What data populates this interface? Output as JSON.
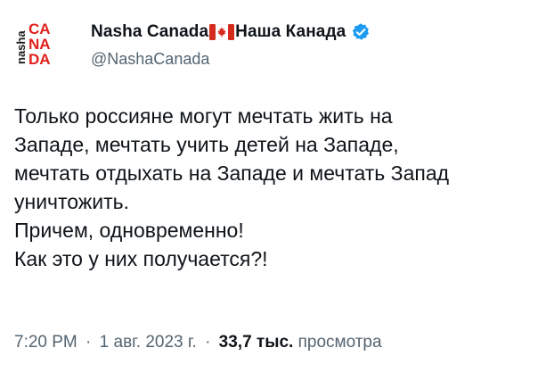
{
  "account": {
    "display_name_latin": "Nasha Canada",
    "display_name_cyrillic": "Наша Канада",
    "handle": "@NashaCanada",
    "verified": true,
    "flag_icon": "canada-flag-icon",
    "verified_icon": "verified-badge-icon",
    "accent_color": "#1d9bf0"
  },
  "avatar": {
    "logo_side_text": "nasha",
    "logo_rows": [
      "CA",
      "NA",
      "DA"
    ],
    "logo_color": "#e0201b",
    "logo_dark": "#1a1a1a"
  },
  "tweet": {
    "lines": [
      "Только россияне могут мечтать жить на",
      "Западе, мечтать учить детей на Западе,",
      "мечтать отдыхать на Западе и мечтать Запад",
      "уничтожить.",
      "Причем, одновременно!",
      "Как это у них получается?!"
    ]
  },
  "meta": {
    "time": "7:20 PM",
    "date": "1 авг. 2023 г.",
    "separator": "·",
    "views_count": "33,7 тыс.",
    "views_label": "просмотра"
  }
}
